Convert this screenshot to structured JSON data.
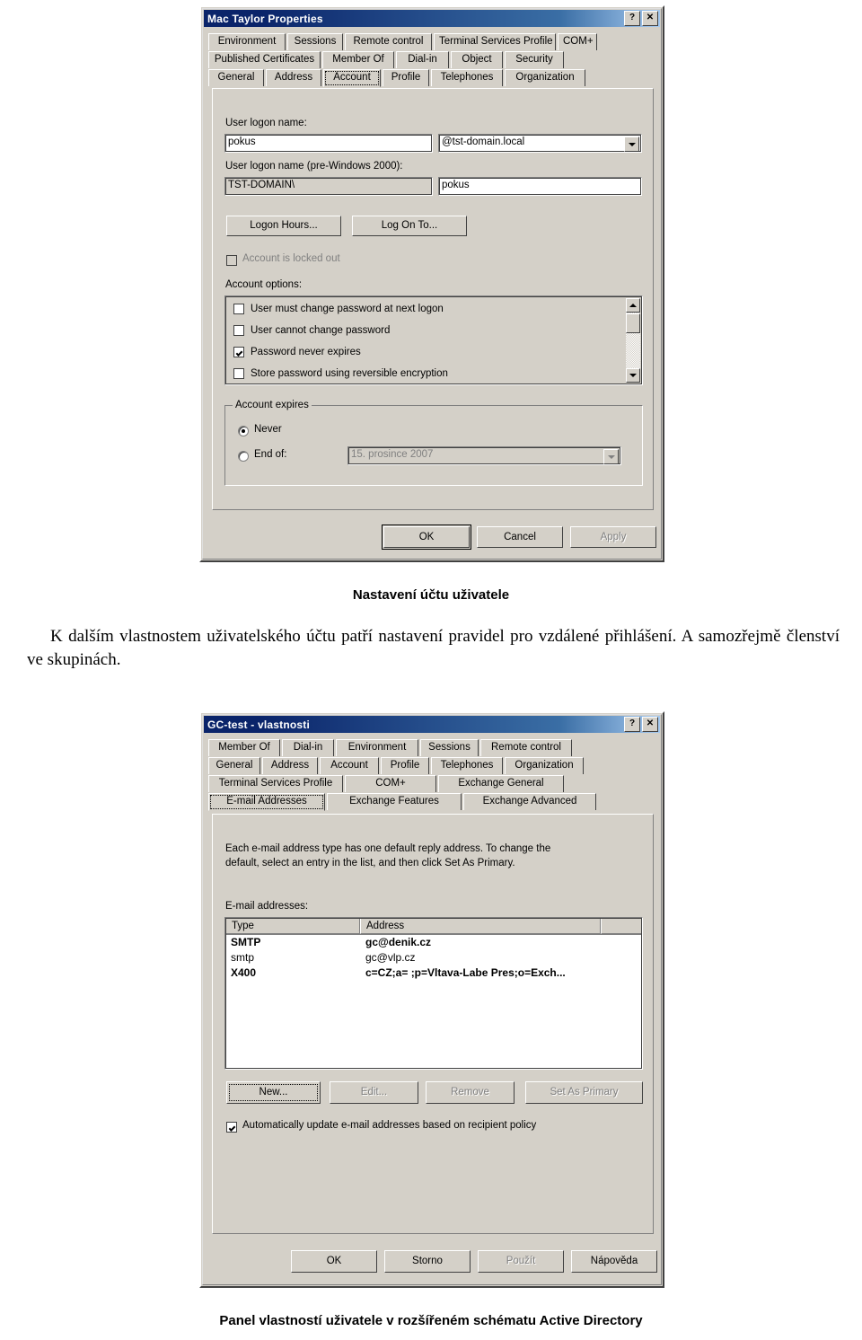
{
  "document": {
    "caption_top": "Nastavení účtu uživatele",
    "paragraph": "K dalším vlastnostem uživatelského účtu patří nastavení pravidel pro vzdálené přihlášení. A samozřejmě členství ve skupinách.",
    "caption_bottom": "Panel vlastností uživatele v rozšířeném schématu Active Directory"
  },
  "dialog1": {
    "title": "Mac Taylor Properties",
    "titlebar_help": "?",
    "titlebar_close": "✕",
    "tab_rows": [
      [
        "Environment",
        "Sessions",
        "Remote control",
        "Terminal Services Profile",
        "COM+"
      ],
      [
        "Published Certificates",
        "Member Of",
        "Dial-in",
        "Object",
        "Security"
      ],
      [
        "General",
        "Address",
        "Account",
        "Profile",
        "Telephones",
        "Organization"
      ]
    ],
    "selected_tab": "Account",
    "logon_name_label": "User logon name:",
    "logon_name_value": "pokus",
    "domain_suffix_value": "@tst-domain.local",
    "pre2000_label": "User logon name (pre-Windows 2000):",
    "pre2000_domain_value": "TST-DOMAIN\\",
    "pre2000_name_value": "pokus",
    "logon_hours_button": "Logon Hours...",
    "log_on_to_button": "Log On To...",
    "locked_out_label": "Account is locked out",
    "locked_out_checked": false,
    "account_options_label": "Account options:",
    "account_options": [
      {
        "label": "User must change password at next logon",
        "checked": false
      },
      {
        "label": "User cannot change password",
        "checked": false
      },
      {
        "label": "Password never expires",
        "checked": true
      },
      {
        "label": "Store password using reversible encryption",
        "checked": false
      }
    ],
    "expires_group_title": "Account expires",
    "expires_never_label": "Never",
    "expires_never_selected": true,
    "expires_endof_label": "End of:",
    "expires_endof_selected": false,
    "expires_date_value": "15. prosince  2007",
    "buttons": {
      "ok": "OK",
      "cancel": "Cancel",
      "apply": "Apply"
    }
  },
  "dialog2": {
    "title": "GC-test - vlastnosti",
    "titlebar_help": "?",
    "titlebar_close": "✕",
    "tab_rows": [
      [
        "Member Of",
        "Dial-in",
        "Environment",
        "Sessions",
        "Remote control"
      ],
      [
        "General",
        "Address",
        "Account",
        "Profile",
        "Telephones",
        "Organization"
      ],
      [
        "Terminal Services Profile",
        "COM+",
        "Exchange General"
      ],
      [
        "E-mail Addresses",
        "Exchange Features",
        "Exchange Advanced"
      ]
    ],
    "selected_tab": "E-mail Addresses",
    "description_line1": "Each e-mail address type has one default reply address. To change the",
    "description_line2": "default, select an entry in the list, and then click Set As Primary.",
    "list_label": "E-mail addresses:",
    "columns": [
      "Type",
      "Address",
      ""
    ],
    "rows": [
      {
        "type": "SMTP",
        "address": "gc@denik.cz",
        "bold": true
      },
      {
        "type": "smtp",
        "address": "gc@vlp.cz",
        "bold": false
      },
      {
        "type": "X400",
        "address": "c=CZ;a= ;p=Vltava-Labe Pres;o=Exch...",
        "bold": true
      }
    ],
    "buttons": {
      "new": "New...",
      "edit": "Edit...",
      "remove": "Remove",
      "set_as_primary": "Set As Primary",
      "ok": "OK",
      "storno": "Storno",
      "pouzit": "Použít",
      "napoveda": "Nápověda"
    },
    "auto_update_label": "Automatically update e-mail addresses based on recipient policy",
    "auto_update_checked": true
  }
}
